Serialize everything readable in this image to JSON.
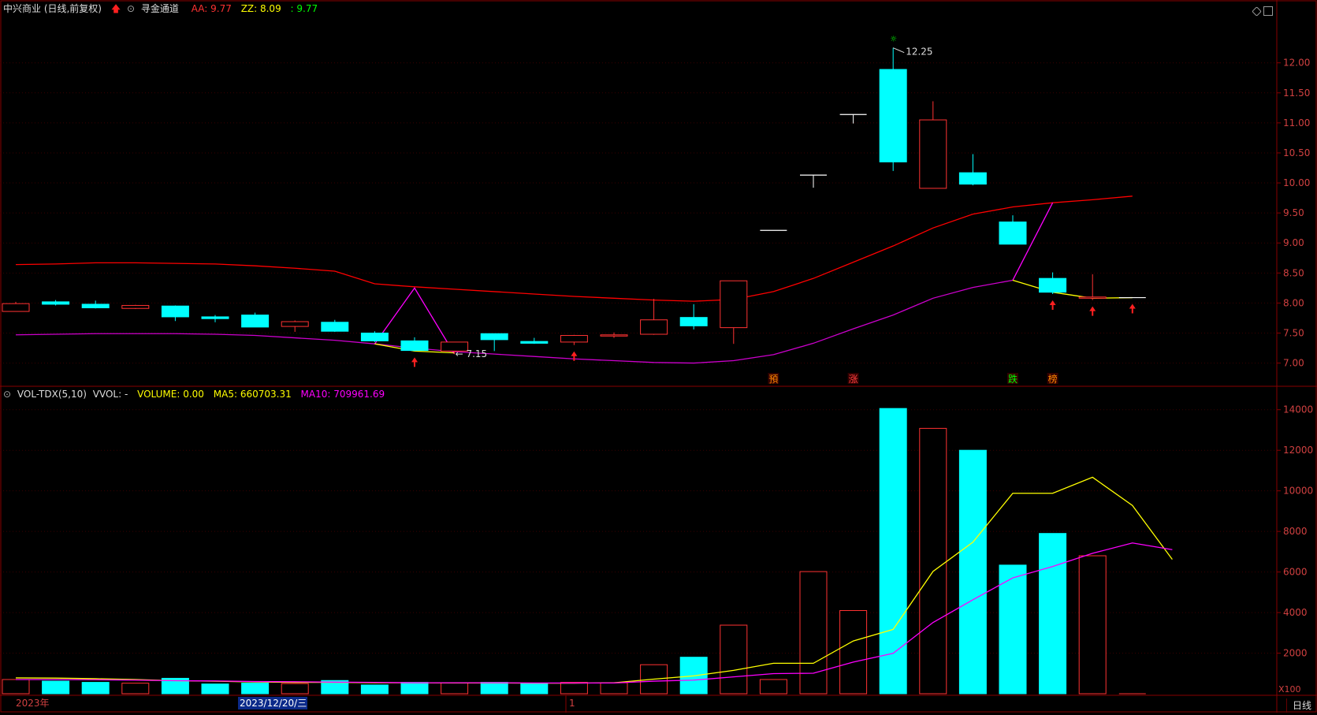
{
  "header": {
    "stock_title": "中兴商业 (日线,前复权)",
    "indicator_name": "寻金通道",
    "aa": "AA: 9.77",
    "zz": "ZZ: 8.09",
    "third": ": 9.77"
  },
  "vol_header": {
    "name": "VOL-TDX(5,10)",
    "vvol": "VVOL: -",
    "volume": "VOLUME: 0.00",
    "ma5": "MA5: 660703.31",
    "ma10": "MA10: 709961.69"
  },
  "colors": {
    "up": "#ff3232",
    "down": "#00ffff",
    "ma5": "#ffff00",
    "ma10": "#ff00ff",
    "upper": "#ff0000",
    "lower": "#cc00cc",
    "grid": "#880000",
    "bg": "#000000"
  },
  "chart_data": [
    {
      "type": "candlestick",
      "title": "中兴商业 (日线,前复权)",
      "yticks": [
        "7.00",
        "7.50",
        "8.00",
        "8.50",
        "9.00",
        "9.50",
        "10.00",
        "10.50",
        "11.00",
        "11.50",
        "12.00"
      ],
      "ylim": [
        6.85,
        12.6
      ],
      "candles": [
        {
          "o": 7.86,
          "h": 8.02,
          "l": 7.86,
          "c": 7.99
        },
        {
          "o": 8.02,
          "h": 8.05,
          "l": 7.96,
          "c": 7.98
        },
        {
          "o": 7.98,
          "h": 8.04,
          "l": 7.91,
          "c": 7.92
        },
        {
          "o": 7.91,
          "h": 7.97,
          "l": 7.9,
          "c": 7.96
        },
        {
          "o": 7.95,
          "h": 7.96,
          "l": 7.7,
          "c": 7.77
        },
        {
          "o": 7.77,
          "h": 7.8,
          "l": 7.68,
          "c": 7.74
        },
        {
          "o": 7.8,
          "h": 7.84,
          "l": 7.6,
          "c": 7.6
        },
        {
          "o": 7.61,
          "h": 7.71,
          "l": 7.52,
          "c": 7.69
        },
        {
          "o": 7.68,
          "h": 7.72,
          "l": 7.52,
          "c": 7.53
        },
        {
          "o": 7.5,
          "h": 7.53,
          "l": 7.35,
          "c": 7.37
        },
        {
          "o": 7.37,
          "h": 7.43,
          "l": 7.2,
          "c": 7.21
        },
        {
          "o": 7.2,
          "h": 7.35,
          "l": 7.15,
          "c": 7.35
        },
        {
          "o": 7.49,
          "h": 7.49,
          "l": 7.2,
          "c": 7.39
        },
        {
          "o": 7.36,
          "h": 7.42,
          "l": 7.32,
          "c": 7.33
        },
        {
          "o": 7.35,
          "h": 7.47,
          "l": 7.3,
          "c": 7.46
        },
        {
          "o": 7.45,
          "h": 7.51,
          "l": 7.42,
          "c": 7.47
        },
        {
          "o": 7.48,
          "h": 8.07,
          "l": 7.47,
          "c": 7.72
        },
        {
          "o": 7.76,
          "h": 7.98,
          "l": 7.56,
          "c": 7.62
        },
        {
          "o": 7.59,
          "h": 8.37,
          "l": 7.32,
          "c": 8.37
        },
        {
          "o": 9.21,
          "h": 9.21,
          "l": 9.21,
          "c": 9.21
        },
        {
          "o": 10.13,
          "h": 10.13,
          "l": 9.92,
          "c": 10.13
        },
        {
          "o": 11.14,
          "h": 11.14,
          "l": 10.99,
          "c": 11.14
        },
        {
          "o": 11.89,
          "h": 12.25,
          "l": 10.2,
          "c": 10.35
        },
        {
          "o": 9.91,
          "h": 11.36,
          "l": 9.91,
          "c": 11.05
        },
        {
          "o": 10.17,
          "h": 10.48,
          "l": 9.96,
          "c": 9.98
        },
        {
          "o": 9.35,
          "h": 9.46,
          "l": 8.98,
          "c": 8.98
        },
        {
          "o": 8.41,
          "h": 8.51,
          "l": 8.15,
          "c": 8.18
        },
        {
          "o": 8.08,
          "h": 8.48,
          "l": 8.05,
          "c": 8.1
        },
        {
          "o": 8.09,
          "h": 8.09,
          "l": 8.09,
          "c": 8.09
        }
      ],
      "upper_band": [
        8.64,
        8.65,
        8.67,
        8.67,
        8.66,
        8.65,
        8.62,
        8.58,
        8.53,
        8.32,
        8.27,
        8.23,
        8.19,
        8.15,
        8.11,
        8.08,
        8.05,
        8.03,
        8.06,
        8.19,
        8.41,
        8.68,
        8.95,
        9.25,
        9.48,
        9.6,
        9.67,
        9.72,
        9.78
      ],
      "lower_band": [
        7.47,
        7.48,
        7.49,
        7.49,
        7.49,
        7.48,
        7.46,
        7.42,
        7.38,
        7.32,
        7.25,
        7.19,
        7.15,
        7.11,
        7.07,
        7.04,
        7.01,
        7.0,
        7.04,
        7.14,
        7.33,
        7.57,
        7.8,
        8.08,
        8.26,
        8.38
      ],
      "zigzag": [
        [
          9,
          7.32
        ],
        [
          10,
          8.25
        ],
        [
          11,
          7.15
        ]
      ],
      "zigzag2": [
        [
          25,
          8.38
        ],
        [
          26,
          9.67
        ]
      ],
      "yellow_support": [
        [
          9,
          7.32
        ],
        [
          10,
          7.2
        ],
        [
          11,
          7.17
        ]
      ],
      "yellow_support2": [
        [
          25,
          8.38
        ],
        [
          26,
          8.18
        ],
        [
          27,
          8.08
        ],
        [
          28,
          8.09
        ]
      ],
      "annotations": {
        "high": "12.25",
        "low": "7.15"
      },
      "signals": [
        "預",
        "涨",
        "跌",
        "榜"
      ],
      "buy_arrows": [
        10,
        14,
        26,
        27,
        28
      ]
    },
    {
      "type": "bar",
      "title": "VOL-TDX(5,10)",
      "yticks": [
        "2000",
        "4000",
        "6000",
        "8000",
        "10000",
        "12000",
        "14000"
      ],
      "ylim": [
        0,
        14300
      ],
      "unit": "X100",
      "volumes": [
        700,
        620,
        560,
        520,
        760,
        480,
        520,
        500,
        650,
        430,
        560,
        540,
        560,
        520,
        560,
        540,
        1430,
        1800,
        3380,
        700,
        6020,
        4100,
        14060,
        13080,
        12000,
        6340,
        7900,
        6800,
        0
      ],
      "ma5": [
        780,
        770,
        740,
        700,
        640,
        620,
        580,
        560,
        560,
        540,
        540,
        530,
        530,
        520,
        520,
        540,
        720,
        880,
        1150,
        1500,
        1500,
        2600,
        3170,
        6030,
        7470,
        9880,
        9880,
        10670,
        9280,
        6620
      ],
      "ma10": [
        700,
        700,
        690,
        670,
        640,
        630,
        600,
        590,
        570,
        560,
        540,
        540,
        540,
        530,
        530,
        530,
        620,
        670,
        830,
        990,
        1010,
        1560,
        1990,
        3510,
        4630,
        5710,
        6270,
        6920,
        7430,
        7100
      ],
      "x_labels": [
        "2023年",
        "2023/12/20/三",
        "1"
      ],
      "period": "日线"
    }
  ]
}
